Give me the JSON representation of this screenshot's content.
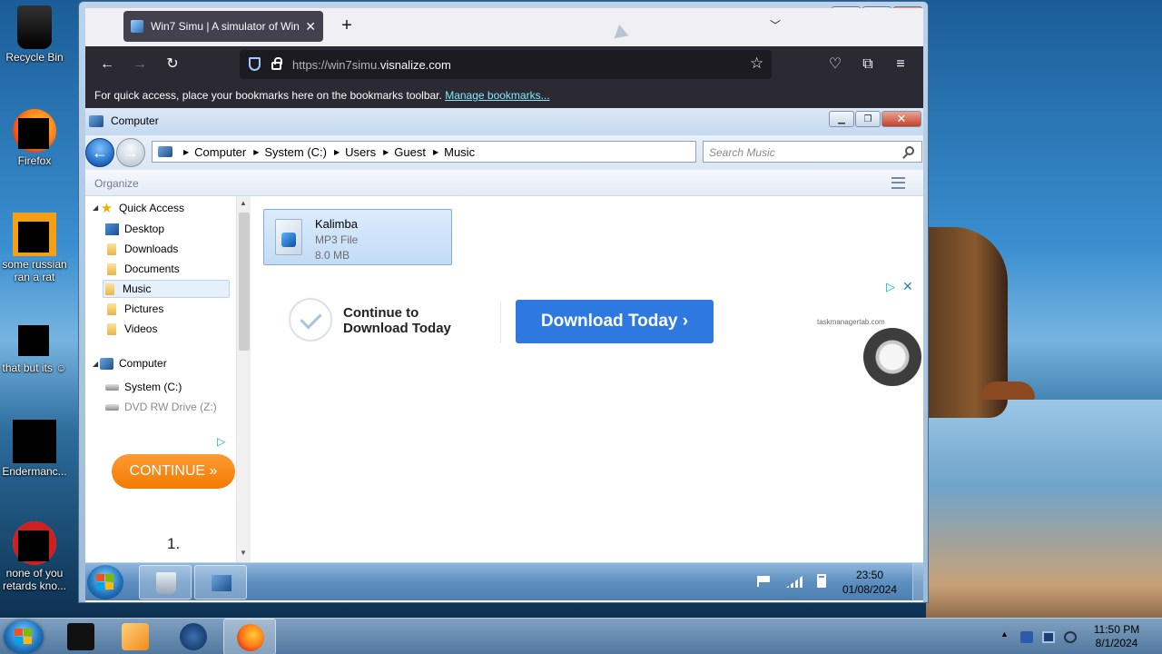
{
  "desktop": {
    "icons": [
      {
        "label": "Recycle Bin"
      },
      {
        "label": "Firefox"
      },
      {
        "label": "some russian ran a rat"
      },
      {
        "label": "that but its ☺"
      },
      {
        "label": "Endermanc..."
      },
      {
        "label": "none of you retards kno..."
      }
    ]
  },
  "host_taskbar": {
    "time": "11:50 PM",
    "date": "8/1/2024"
  },
  "browser": {
    "tab_title": "Win7 Simu | A simulator of Win",
    "new_tab": "+",
    "url_dim": "https://win7simu.",
    "url_main": "visnalize.com",
    "bookmarks_message": "For quick access, place your bookmarks here on the bookmarks toolbar.",
    "bookmarks_link": "Manage bookmarks..."
  },
  "explorer": {
    "title": "Computer",
    "breadcrumbs": [
      "Computer",
      "System (C:)",
      "Users",
      "Guest",
      "Music"
    ],
    "search_placeholder": "Search Music",
    "organize": "Organize",
    "nav": {
      "quick_access": "Quick Access",
      "quick_items": [
        "Desktop",
        "Downloads",
        "Documents",
        "Music",
        "Pictures",
        "Videos"
      ],
      "computer": "Computer",
      "drives": [
        "System (C:)",
        "DVD RW Drive (Z:)"
      ]
    },
    "files": [
      {
        "name": "Kalimba",
        "type": "MP3 File",
        "size": "8.0 MB"
      }
    ],
    "side_ad_button": "CONTINUE »",
    "side_number": "1."
  },
  "ad": {
    "text_line1": "Continue to",
    "text_line2": "Download Today",
    "button": "Download Today ›",
    "domain": "taskmanagertab.com",
    "choices_icon": "▷",
    "close": "✕"
  },
  "sim_taskbar": {
    "time": "23:50",
    "date": "01/08/2024"
  }
}
